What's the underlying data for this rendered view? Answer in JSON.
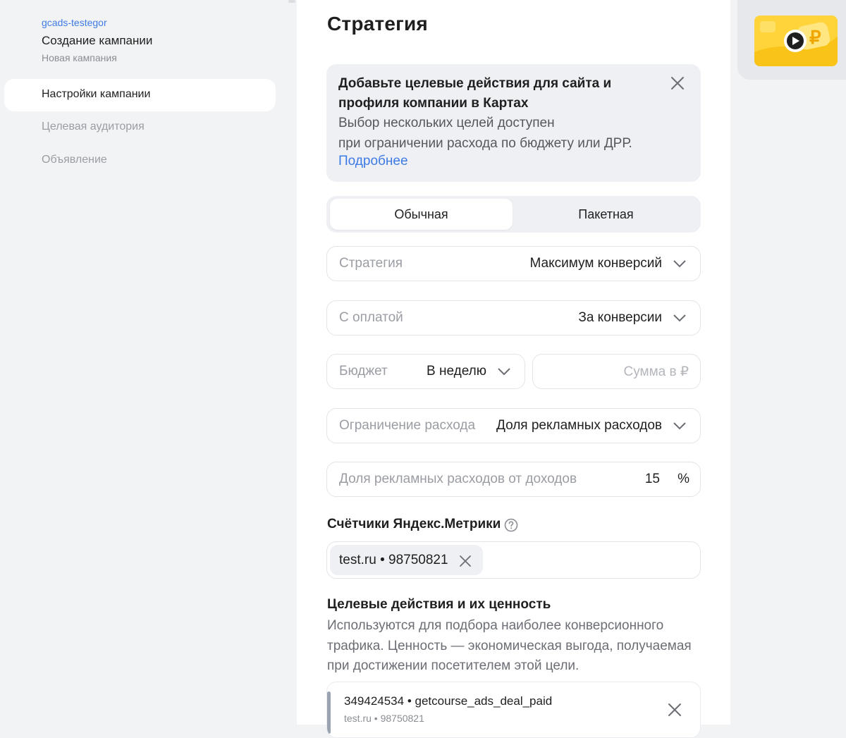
{
  "sidebar": {
    "account": "gcads-testegor",
    "title": "Создание кампании",
    "subtitle": "Новая кампания",
    "items": [
      {
        "label": "Настройки кампании",
        "active": true
      },
      {
        "label": "Целевая аудитория",
        "active": false
      },
      {
        "label": "Объявление",
        "active": false
      }
    ]
  },
  "main": {
    "title": "Стратегия",
    "banner": {
      "title": "Добавьте целевые действия для сайта и профиля компании в Картах",
      "text_line1": "Выбор нескольких целей доступен",
      "text_line2": "при ограничении расхода по бюджету или ДРР.",
      "link": "Подробнее",
      "close_icon": "close-icon"
    },
    "segments": {
      "active": "Обычная",
      "other": "Пакетная"
    },
    "strategy": {
      "label": "Стратегия",
      "value": "Максимум конверсий"
    },
    "payment": {
      "label": "С оплатой",
      "value": "За конверсии"
    },
    "budget": {
      "label": "Бюджет",
      "value": "В неделю",
      "amount_placeholder": "Сумма в ₽"
    },
    "limit": {
      "label": "Ограничение расхода",
      "value": "Доля рекламных расходов"
    },
    "drr": {
      "label": "Доля рекламных расходов от доходов",
      "value": "15",
      "unit": "%"
    },
    "metrika": {
      "title": "Счётчики Яндекс.Метрики",
      "help_icon": "question-circle-icon",
      "chip": "test.ru • 98750821"
    },
    "goals": {
      "title": "Целевые действия и их ценность",
      "description": "Используются для подбора наиболее конверсионного трафика. Ценность — экономическая выгода, получаемая при достижении посетителем этой цели.",
      "items": [
        {
          "name": "349424534 • getcourse_ads_deal_paid",
          "sub": "test.ru • 98750821"
        }
      ]
    }
  },
  "promo": {
    "icon": "play-video-icon",
    "accent": "#ffd43b"
  }
}
